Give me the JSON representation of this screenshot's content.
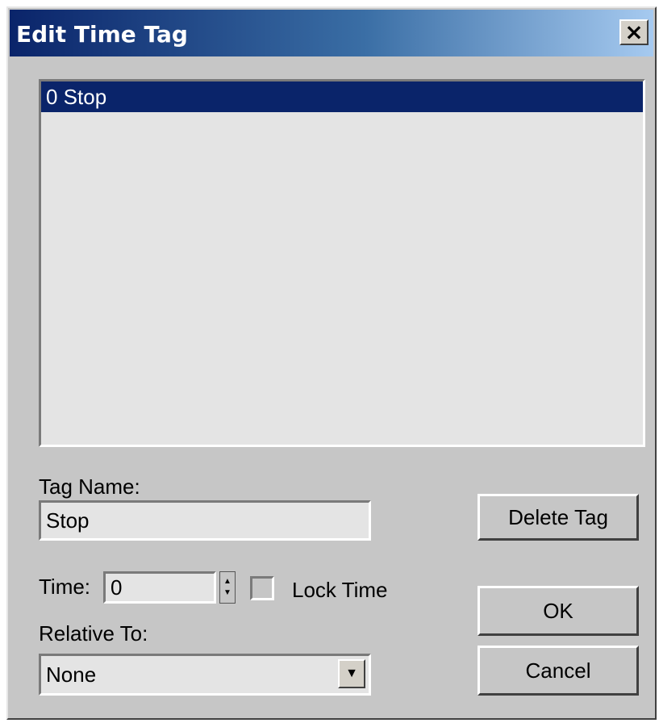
{
  "window": {
    "title": "Edit Time Tag",
    "close_glyph": "×"
  },
  "list": {
    "items": [
      {
        "label": "0 Stop",
        "selected": true
      }
    ]
  },
  "tag_name": {
    "label": "Tag Name:",
    "value": "Stop"
  },
  "time": {
    "label": "Time:",
    "value": "0",
    "spinner_up": "▲",
    "spinner_down": "▼"
  },
  "lock_time": {
    "label": "Lock Time",
    "checked": false
  },
  "relative_to": {
    "label": "Relative To:",
    "value": "None",
    "arrow_glyph": "▼"
  },
  "buttons": {
    "delete_tag": "Delete Tag",
    "ok": "OK",
    "cancel": "Cancel"
  },
  "colors": {
    "selection": "#0a246a",
    "dialog_bg": "#c6c6c6",
    "field_bg": "#e4e4e4"
  }
}
